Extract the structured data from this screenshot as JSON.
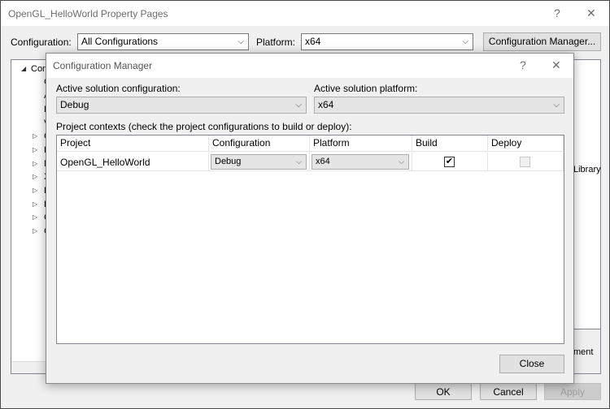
{
  "outer": {
    "title": "OpenGL_HelloWorld Property Pages",
    "help_glyph": "?",
    "close_glyph": "✕",
    "configuration_label": "Configuration:",
    "configuration_value": "All Configurations",
    "platform_label": "Platform:",
    "platform_value": "x64",
    "config_manager_button": "Configuration Manager...",
    "tree_items": [
      {
        "label": "Con",
        "expander": "◢"
      },
      {
        "label": "G",
        "expander": ""
      },
      {
        "label": "A",
        "expander": ""
      },
      {
        "label": "D",
        "expander": ""
      },
      {
        "label": "V",
        "expander": ""
      },
      {
        "label": "C",
        "expander": "▷"
      },
      {
        "label": "L",
        "expander": "▷"
      },
      {
        "label": "M",
        "expander": "▷"
      },
      {
        "label": "X",
        "expander": "▷"
      },
      {
        "label": "B",
        "expander": "▷"
      },
      {
        "label": "B",
        "expander": "▷"
      },
      {
        "label": "C",
        "expander": "▷"
      },
      {
        "label": "C",
        "expander": "▷"
      }
    ],
    "right_panel_text": "Library",
    "right_panel_text2": "ment",
    "ok_button": "OK",
    "cancel_button": "Cancel",
    "apply_button": "Apply"
  },
  "dialog": {
    "title": "Configuration Manager",
    "help_glyph": "?",
    "close_glyph": "✕",
    "active_config_label": "Active solution configuration:",
    "active_config_value": "Debug",
    "active_platform_label": "Active solution platform:",
    "active_platform_value": "x64",
    "contexts_label": "Project contexts (check the project configurations to build or deploy):",
    "columns": [
      "Project",
      "Configuration",
      "Platform",
      "Build",
      "Deploy"
    ],
    "rows": [
      {
        "project": "OpenGL_HelloWorld",
        "configuration": "Debug",
        "platform": "x64",
        "build": true,
        "deploy": false,
        "build_mark": "✔"
      }
    ],
    "close_button": "Close"
  }
}
